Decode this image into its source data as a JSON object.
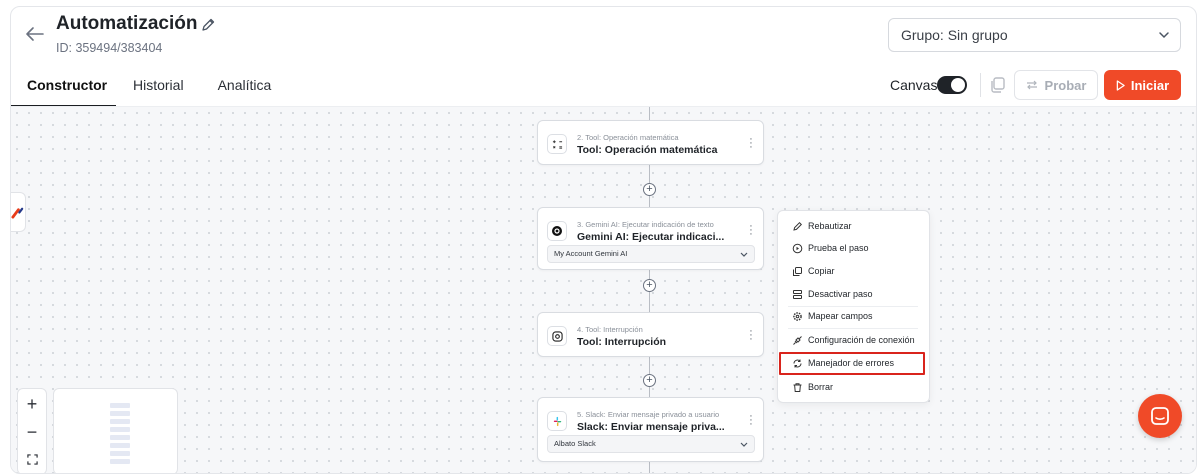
{
  "header": {
    "title": "Automatización",
    "subtitle": "ID: 359494/383404",
    "group_select": "Grupo: Sin grupo"
  },
  "tabs": [
    {
      "label": "Constructor",
      "active": true
    },
    {
      "label": "Historial",
      "active": false
    },
    {
      "label": "Analítica",
      "active": false
    }
  ],
  "toolbar": {
    "canvas_label": "Canvas",
    "canvas_on": true,
    "probar_label": "Probar",
    "iniciar_label": "Iniciar"
  },
  "colors": {
    "accent": "#f04a28",
    "highlight": "#d9241c"
  },
  "nodes": [
    {
      "subtitle": "2. Tool: Operación matemática",
      "title": "Tool: Operación matemática",
      "icon": "math-icon"
    },
    {
      "subtitle": "3. Gemini AI: Ejecutar indicación de texto",
      "title": "Gemini AI: Ejecutar indicaci...",
      "icon": "gemini-icon",
      "select": "My Account Gemini AI"
    },
    {
      "subtitle": "4. Tool: Interrupción",
      "title": "Tool: Interrupción",
      "icon": "interruption-icon"
    },
    {
      "subtitle": "5. Slack: Enviar mensaje privado a usuario",
      "title": "Slack: Enviar mensaje priva...",
      "icon": "slack-icon",
      "select": "Albato Slack"
    }
  ],
  "context_menu": {
    "items": [
      {
        "label": "Rebautizar",
        "icon": "pencil-icon"
      },
      {
        "label": "Prueba el paso",
        "icon": "play-circle-icon"
      },
      {
        "label": "Copiar",
        "icon": "copy-icon"
      },
      {
        "label": "Desactivar paso",
        "icon": "disable-icon"
      },
      {
        "label": "Mapear campos",
        "icon": "gear-icon"
      },
      {
        "label": "Configuración de conexión",
        "icon": "plug-icon"
      },
      {
        "label": "Manejador de errores",
        "icon": "error-handler-icon",
        "highlighted": true
      },
      {
        "label": "Borrar",
        "icon": "trash-icon"
      }
    ]
  },
  "zoom": {
    "zoom_in": "+",
    "zoom_out": "−"
  }
}
